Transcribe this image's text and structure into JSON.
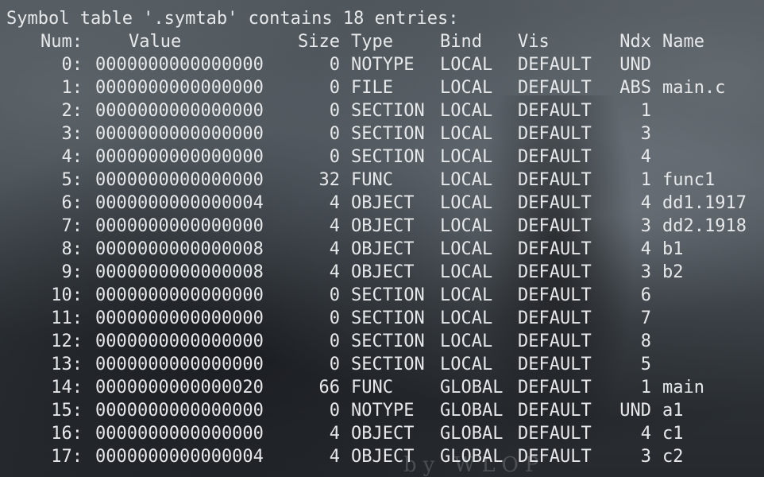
{
  "title": "Symbol table '.symtab' contains 18 entries:",
  "headers": {
    "num": "Num:",
    "value": "Value",
    "size": "Size",
    "type": "Type",
    "bind": "Bind",
    "vis": "Vis",
    "ndx": "Ndx",
    "name": "Name"
  },
  "rows": [
    {
      "num": "0:",
      "value": "0000000000000000",
      "size": "0",
      "type": "NOTYPE",
      "bind": "LOCAL",
      "vis": "DEFAULT",
      "ndx": "UND",
      "name": ""
    },
    {
      "num": "1:",
      "value": "0000000000000000",
      "size": "0",
      "type": "FILE",
      "bind": "LOCAL",
      "vis": "DEFAULT",
      "ndx": "ABS",
      "name": "main.c"
    },
    {
      "num": "2:",
      "value": "0000000000000000",
      "size": "0",
      "type": "SECTION",
      "bind": "LOCAL",
      "vis": "DEFAULT",
      "ndx": "1",
      "name": ""
    },
    {
      "num": "3:",
      "value": "0000000000000000",
      "size": "0",
      "type": "SECTION",
      "bind": "LOCAL",
      "vis": "DEFAULT",
      "ndx": "3",
      "name": ""
    },
    {
      "num": "4:",
      "value": "0000000000000000",
      "size": "0",
      "type": "SECTION",
      "bind": "LOCAL",
      "vis": "DEFAULT",
      "ndx": "4",
      "name": ""
    },
    {
      "num": "5:",
      "value": "0000000000000000",
      "size": "32",
      "type": "FUNC",
      "bind": "LOCAL",
      "vis": "DEFAULT",
      "ndx": "1",
      "name": "func1"
    },
    {
      "num": "6:",
      "value": "0000000000000004",
      "size": "4",
      "type": "OBJECT",
      "bind": "LOCAL",
      "vis": "DEFAULT",
      "ndx": "4",
      "name": "dd1.1917"
    },
    {
      "num": "7:",
      "value": "0000000000000000",
      "size": "4",
      "type": "OBJECT",
      "bind": "LOCAL",
      "vis": "DEFAULT",
      "ndx": "3",
      "name": "dd2.1918"
    },
    {
      "num": "8:",
      "value": "0000000000000008",
      "size": "4",
      "type": "OBJECT",
      "bind": "LOCAL",
      "vis": "DEFAULT",
      "ndx": "4",
      "name": "b1"
    },
    {
      "num": "9:",
      "value": "0000000000000008",
      "size": "4",
      "type": "OBJECT",
      "bind": "LOCAL",
      "vis": "DEFAULT",
      "ndx": "3",
      "name": "b2"
    },
    {
      "num": "10:",
      "value": "0000000000000000",
      "size": "0",
      "type": "SECTION",
      "bind": "LOCAL",
      "vis": "DEFAULT",
      "ndx": "6",
      "name": ""
    },
    {
      "num": "11:",
      "value": "0000000000000000",
      "size": "0",
      "type": "SECTION",
      "bind": "LOCAL",
      "vis": "DEFAULT",
      "ndx": "7",
      "name": ""
    },
    {
      "num": "12:",
      "value": "0000000000000000",
      "size": "0",
      "type": "SECTION",
      "bind": "LOCAL",
      "vis": "DEFAULT",
      "ndx": "8",
      "name": ""
    },
    {
      "num": "13:",
      "value": "0000000000000000",
      "size": "0",
      "type": "SECTION",
      "bind": "LOCAL",
      "vis": "DEFAULT",
      "ndx": "5",
      "name": ""
    },
    {
      "num": "14:",
      "value": "0000000000000020",
      "size": "66",
      "type": "FUNC",
      "bind": "GLOBAL",
      "vis": "DEFAULT",
      "ndx": "1",
      "name": "main"
    },
    {
      "num": "15:",
      "value": "0000000000000000",
      "size": "0",
      "type": "NOTYPE",
      "bind": "GLOBAL",
      "vis": "DEFAULT",
      "ndx": "UND",
      "name": "a1"
    },
    {
      "num": "16:",
      "value": "0000000000000000",
      "size": "4",
      "type": "OBJECT",
      "bind": "GLOBAL",
      "vis": "DEFAULT",
      "ndx": "4",
      "name": "c1"
    },
    {
      "num": "17:",
      "value": "0000000000000004",
      "size": "4",
      "type": "OBJECT",
      "bind": "GLOBAL",
      "vis": "DEFAULT",
      "ndx": "3",
      "name": "c2"
    }
  ],
  "watermark": "by WLOP"
}
